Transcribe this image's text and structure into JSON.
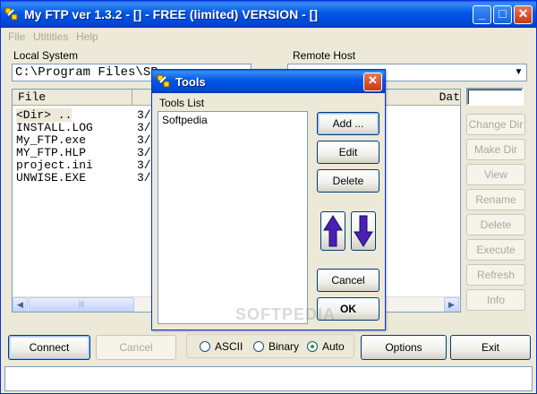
{
  "window": {
    "title": "My FTP ver 1.3.2 -  []  - FREE (limited) VERSION - []",
    "minimize_glyph": "_",
    "maximize_glyph": "□",
    "close_glyph": "✕"
  },
  "menu": [
    {
      "label": "File"
    },
    {
      "label": "Utitities"
    },
    {
      "label": "Help"
    }
  ],
  "local": {
    "group_label": "Local System",
    "path": "C:\\Program Files\\SP",
    "column_header": "File",
    "files": [
      {
        "name": "<Dir> ..",
        "date": "3/"
      },
      {
        "name": "INSTALL.LOG",
        "date": "3/"
      },
      {
        "name": "My_FTP.exe",
        "date": "3/"
      },
      {
        "name": "MY_FTP.HLP",
        "date": "3/"
      },
      {
        "name": "project.ini",
        "date": "3/"
      },
      {
        "name": "UNWISE.EXE",
        "date": "3/"
      }
    ]
  },
  "remote": {
    "group_label": "Remote Host",
    "path": "",
    "date_header": "Dat",
    "buttons": [
      {
        "label": "Change Dir"
      },
      {
        "label": "Make Dir"
      },
      {
        "label": "View"
      },
      {
        "label": "Rename"
      },
      {
        "label": "Delete"
      },
      {
        "label": "Execute"
      },
      {
        "label": "Refresh"
      },
      {
        "label": "Info"
      }
    ]
  },
  "bottom": {
    "connect": "Connect",
    "cancel": "Cancel",
    "modes": [
      {
        "label": "ASCII",
        "selected": false
      },
      {
        "label": "Binary",
        "selected": false
      },
      {
        "label": "Auto",
        "selected": true
      }
    ],
    "options": "Options",
    "exit": "Exit"
  },
  "tools_dialog": {
    "title": "Tools",
    "list_label": "Tools List",
    "items": [
      "Softpedia"
    ],
    "add": "Add ...",
    "edit": "Edit",
    "delete": "Delete",
    "cancel": "Cancel",
    "ok": "OK"
  },
  "watermark": "SOFTPEDIA"
}
